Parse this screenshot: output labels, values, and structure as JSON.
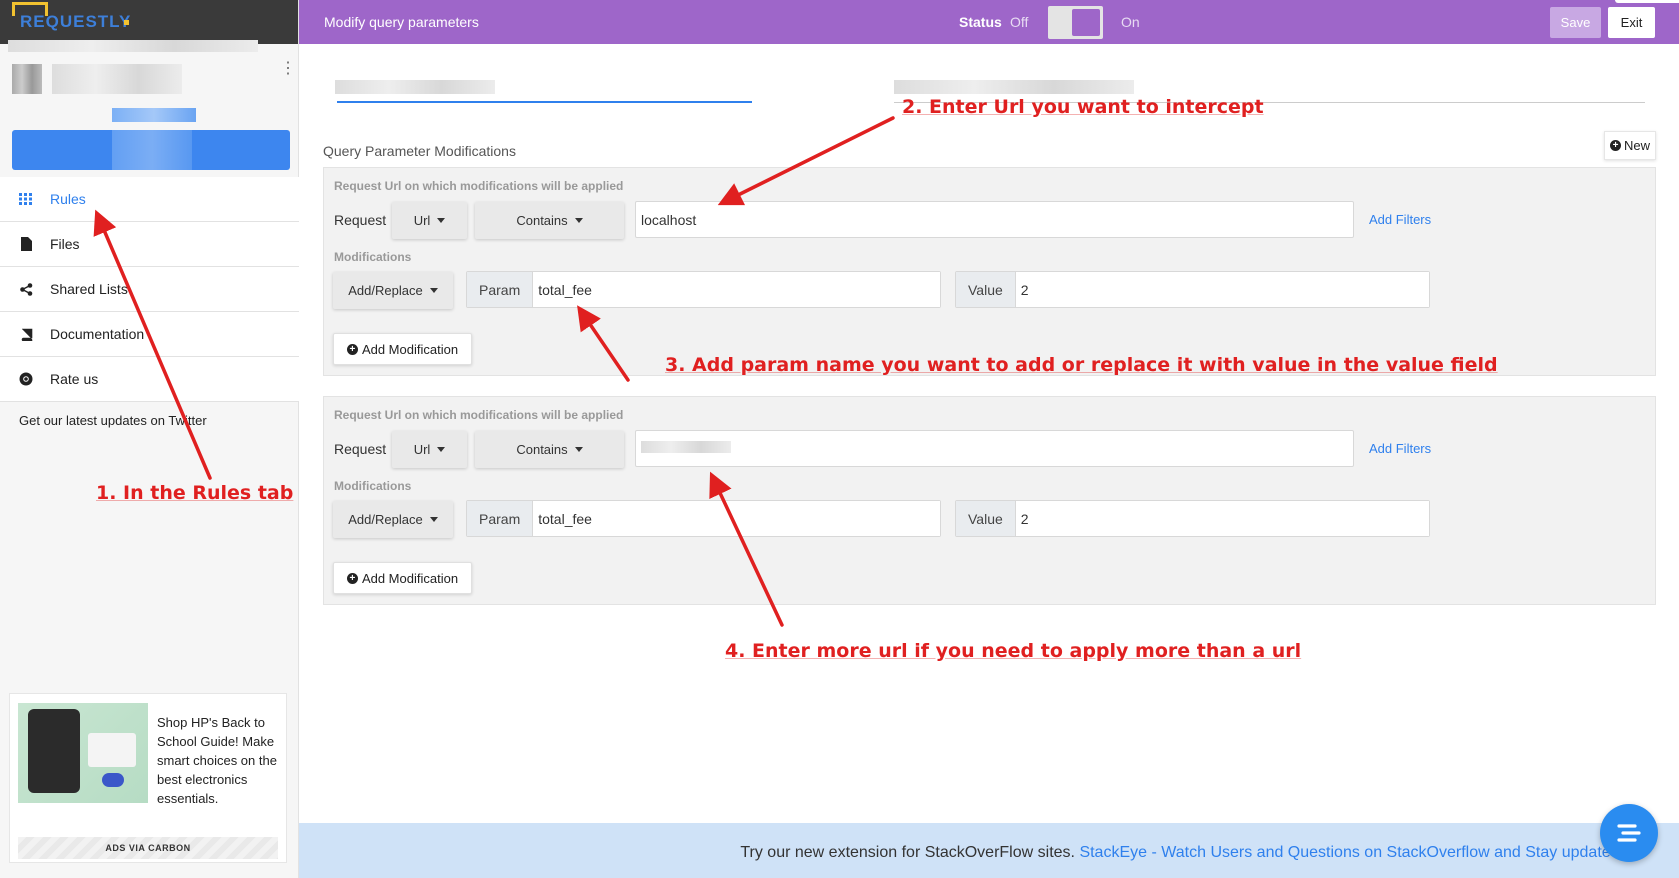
{
  "app": {
    "logo": "REQUESTLY",
    "title": "Modify query parameters"
  },
  "topbar": {
    "status_label": "Status",
    "off_label": "Off",
    "on_label": "On",
    "save_label": "Save",
    "exit_label": "Exit",
    "accent": "#9e66c9"
  },
  "sidebar": {
    "items": [
      {
        "label": "Rules",
        "icon": "grid-icon",
        "active": true
      },
      {
        "label": "Files",
        "icon": "file-icon",
        "active": false
      },
      {
        "label": "Shared Lists",
        "icon": "share-icon",
        "active": false
      },
      {
        "label": "Documentation",
        "icon": "book-icon",
        "active": false
      },
      {
        "label": "Rate us",
        "icon": "chrome-icon",
        "active": false
      }
    ],
    "twitter_note": "Get our latest updates on Twitter",
    "ad": {
      "text": "Shop HP's Back to School Guide! Make smart choices on the best electronics essentials.",
      "footer": "ADS VIA CARBON"
    }
  },
  "main": {
    "section_title": "Query Parameter Modifications",
    "new_label": "New",
    "blocks": [
      {
        "hint": "Request Url on which modifications will be applied",
        "request_label": "Request",
        "source_key": "Url",
        "operator": "Contains",
        "url_value": "localhost",
        "add_filters": "Add Filters",
        "mods_label": "Modifications",
        "mod_type": "Add/Replace",
        "param_label": "Param",
        "param_value": "total_fee",
        "value_label": "Value",
        "value_value": "2",
        "add_mod_label": "Add Modification"
      },
      {
        "hint": "Request Url on which modifications will be applied",
        "request_label": "Request",
        "source_key": "Url",
        "operator": "Contains",
        "url_value": "",
        "add_filters": "Add Filters",
        "mods_label": "Modifications",
        "mod_type": "Add/Replace",
        "param_label": "Param",
        "param_value": "total_fee",
        "value_label": "Value",
        "value_value": "2",
        "add_mod_label": "Add Modification"
      }
    ]
  },
  "annotations": {
    "step1": "1. In the Rules tab",
    "step2": "2. Enter Url you want to intercept",
    "step3": "3. Add param name you want to add or replace it with value in the value field",
    "step4": "4. Enter more url if you need to apply more than a url"
  },
  "footer": {
    "text": "Try our new extension for StackOverFlow sites.",
    "link": "StackEye - Watch Users and Questions on StackOverflow and Stay updated!"
  }
}
